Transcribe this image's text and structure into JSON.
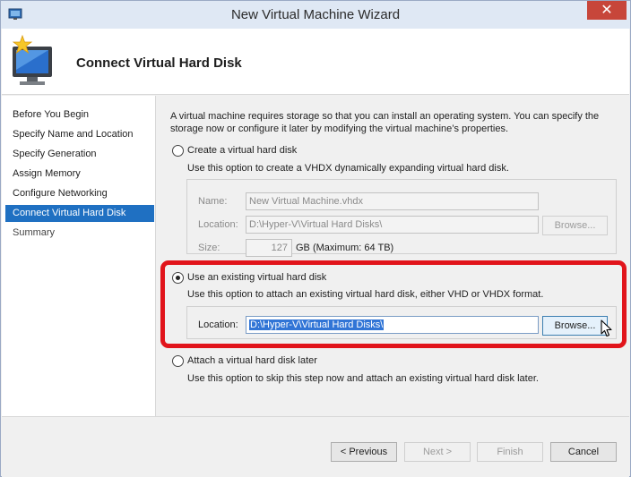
{
  "window": {
    "title": "New Virtual Machine Wizard",
    "close_glyph": "✕"
  },
  "header": {
    "title": "Connect Virtual Hard Disk"
  },
  "nav": {
    "items": [
      {
        "label": "Before You Begin",
        "active": false
      },
      {
        "label": "Specify Name and Location",
        "active": false
      },
      {
        "label": "Specify Generation",
        "active": false
      },
      {
        "label": "Assign Memory",
        "active": false
      },
      {
        "label": "Configure Networking",
        "active": false
      },
      {
        "label": "Connect Virtual Hard Disk",
        "active": true
      },
      {
        "label": "Summary",
        "active": false
      }
    ]
  },
  "main": {
    "intro": "A virtual machine requires storage so that you can install an operating system. You can specify the storage now or configure it later by modifying the virtual machine’s properties.",
    "options": {
      "create": {
        "label": "Create a virtual hard disk",
        "description": "Use this option to create a VHDX dynamically expanding virtual hard disk.",
        "selected": false,
        "name_label": "Name:",
        "name_value": "New Virtual Machine.vhdx",
        "location_label": "Location:",
        "location_value": "D:\\Hyper-V\\Virtual Hard Disks\\",
        "browse_label": "Browse...",
        "size_label": "Size:",
        "size_value": "127",
        "size_unit": "GB (Maximum: 64 TB)"
      },
      "existing": {
        "label": "Use an existing virtual hard disk",
        "description": "Use this option to attach an existing virtual hard disk, either VHD or VHDX format.",
        "selected": true,
        "location_label": "Location:",
        "location_value": "D:\\Hyper-V\\Virtual Hard Disks\\",
        "browse_label": "Browse..."
      },
      "later": {
        "label": "Attach a virtual hard disk later",
        "description": "Use this option to skip this step now and attach an existing virtual hard disk later.",
        "selected": false
      }
    },
    "highlight_color": "#e1141b"
  },
  "footer": {
    "previous_label": "< Previous",
    "next_label": "Next >",
    "finish_label": "Finish",
    "cancel_label": "Cancel"
  },
  "colors": {
    "accent": "#1f70c2",
    "selection": "#3175d6",
    "close_button": "#c7463a"
  },
  "icons": {
    "app": "hyper-v-app-icon",
    "wizard": "monitor-star-icon",
    "cursor": "mouse-pointer-icon"
  }
}
